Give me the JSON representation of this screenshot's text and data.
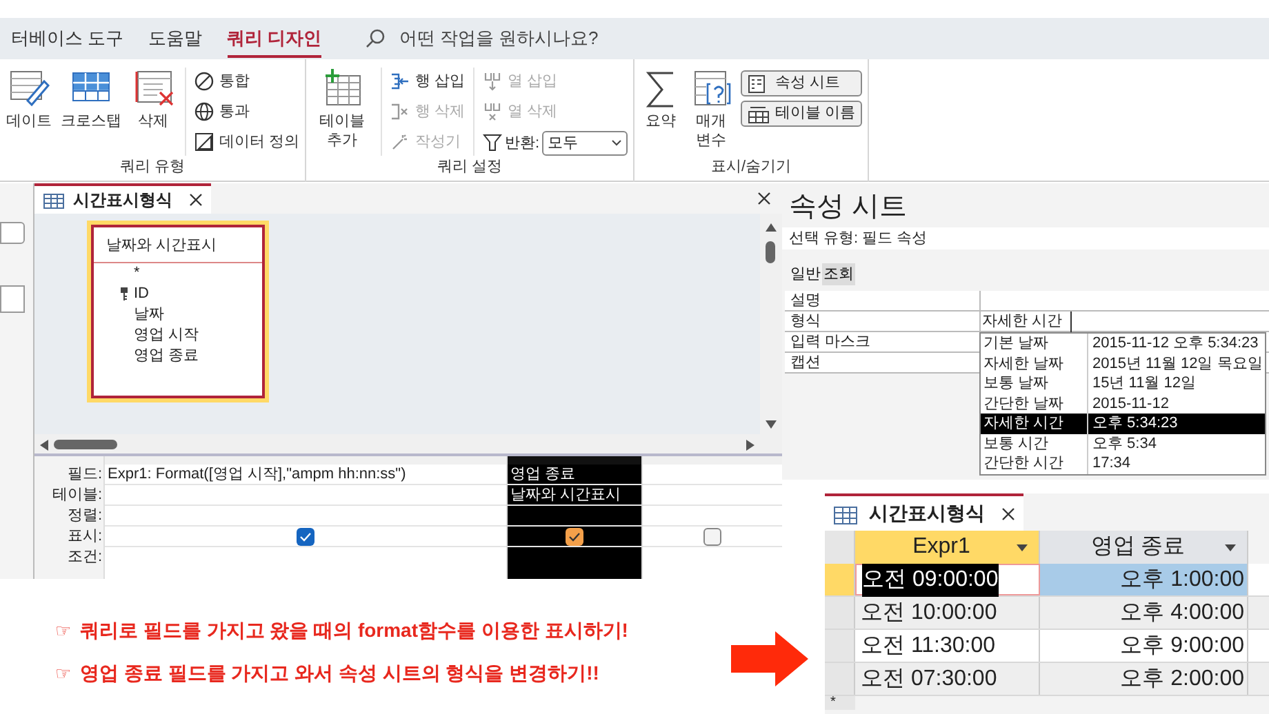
{
  "ribbon": {
    "tabs": [
      {
        "label": "터베이스 도구",
        "selected": false
      },
      {
        "label": "도움말",
        "selected": false
      },
      {
        "label": "쿼리 디자인",
        "selected": true
      }
    ],
    "search": {
      "placeholder": "어떤 작업을 원하시나요?"
    },
    "groups": [
      {
        "label": "쿼리 유형",
        "items": [
          {
            "kind": "large",
            "label": "데이트"
          },
          {
            "kind": "large",
            "label": "크로스탭"
          },
          {
            "kind": "large",
            "label": "삭제"
          },
          {
            "kind": "small",
            "label": "통합",
            "disabled": false
          },
          {
            "kind": "small",
            "label": "통과",
            "disabled": false
          },
          {
            "kind": "small",
            "label": "데이터 정의",
            "disabled": false
          }
        ]
      },
      {
        "label": "쿼리 설정",
        "items": [
          {
            "kind": "large",
            "label": "테이블 추가"
          },
          {
            "kind": "small",
            "label": "행 삽입",
            "disabled": false
          },
          {
            "kind": "small",
            "label": "행 삭제",
            "disabled": true
          },
          {
            "kind": "small",
            "label": "작성기",
            "disabled": true
          },
          {
            "kind": "small",
            "label": "열 삽입",
            "disabled": true
          },
          {
            "kind": "small",
            "label": "열 삭제",
            "disabled": true
          },
          {
            "kind": "select",
            "label": "반환:",
            "value": "모두"
          }
        ]
      },
      {
        "label": "표시/숨기기",
        "items": [
          {
            "kind": "large",
            "label": "요약"
          },
          {
            "kind": "large",
            "label": "매개 변수"
          },
          {
            "kind": "boxed",
            "label": "속성 시트"
          },
          {
            "kind": "boxed",
            "label": "테이블 이름"
          }
        ]
      }
    ]
  },
  "query_window": {
    "tab": "시간표시형식",
    "table_box": {
      "title": "날짜와 시간표시",
      "fields": [
        {
          "name": "*",
          "key": false
        },
        {
          "name": "ID",
          "key": true
        },
        {
          "name": "날짜",
          "key": false
        },
        {
          "name": "영업 시작",
          "key": false
        },
        {
          "name": "영업 종료",
          "key": false
        }
      ]
    },
    "row_labels": [
      "필드:",
      "테이블:",
      "정렬:",
      "표시:",
      "조건:"
    ],
    "columns": [
      {
        "field": "Expr1: Format([영업 시작],\"ampm hh:nn:ss\")",
        "show": true,
        "selected": false
      },
      {
        "field": "영업 종료",
        "table": "날짜와 시간표시",
        "show": true,
        "selected": true
      },
      {
        "show": false,
        "selected": false
      }
    ]
  },
  "property_sheet": {
    "title": "속성 시트",
    "selection_type": "선택 유형: 필드 속성",
    "tabs": [
      {
        "label": "일반",
        "selected": true
      },
      {
        "label": "조회",
        "selected": false
      }
    ],
    "properties": [
      {
        "name": "설명"
      },
      {
        "name": "형식",
        "value": "자세한 시간"
      },
      {
        "name": "입력 마스크"
      },
      {
        "name": "캡션"
      }
    ],
    "format_options": [
      {
        "name": "기본 날짜",
        "example": "2015-11-12 오후 5:34:23",
        "selected": false
      },
      {
        "name": "자세한 날짜",
        "example": "2015년 11월 12일 목요일",
        "selected": false
      },
      {
        "name": "보통 날짜",
        "example": "15년 11월 12일",
        "selected": false
      },
      {
        "name": "간단한 날짜",
        "example": "2015-11-12",
        "selected": false
      },
      {
        "name": "자세한 시간",
        "example": "오후 5:34:23",
        "selected": true
      },
      {
        "name": "보통 시간",
        "example": "오후 5:34",
        "selected": false
      },
      {
        "name": "간단한 시간",
        "example": "17:34",
        "selected": false
      }
    ]
  },
  "datasheet": {
    "tab": "시간표시형식",
    "columns": [
      {
        "label": "Expr1",
        "selected": true
      },
      {
        "label": "영업 종료",
        "selected": false
      }
    ],
    "rows": [
      {
        "cells": [
          "오전 09:00:00",
          "오후 1:00:00"
        ],
        "current": true
      },
      {
        "cells": [
          "오전 10:00:00",
          "오후 4:00:00"
        ],
        "current": false
      },
      {
        "cells": [
          "오전 11:30:00",
          "오후 9:00:00"
        ],
        "current": false
      },
      {
        "cells": [
          "오전 07:30:00",
          "오후 2:00:00"
        ],
        "current": false
      }
    ],
    "new_row_marker": "*"
  },
  "notes": [
    {
      "marker": "☞",
      "text": "쿼리로 필드를 가지고 왔을 때의 format함수를 이용한 표시하기!"
    },
    {
      "marker": "☞",
      "text": "영업 종료 필드를 가지고 와서 속성 시트의 형식을 변경하기!!"
    }
  ]
}
